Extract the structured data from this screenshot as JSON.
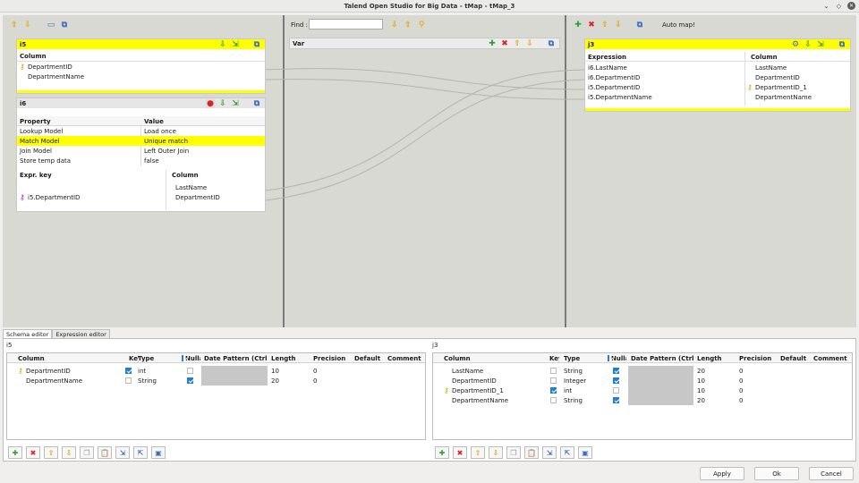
{
  "window": {
    "title": "Talend Open Studio for Big Data - tMap - tMap_3"
  },
  "var_panel": {
    "find_label": "Find :",
    "find_value": "",
    "title": "Var"
  },
  "output_toolbar": {
    "auto_map": "Auto map!"
  },
  "i5": {
    "title": "i5",
    "column_header": "Column",
    "rows": [
      "DepartmentID",
      "DepartmentName"
    ]
  },
  "i6": {
    "title": "i6",
    "prop_headers": [
      "Property",
      "Value"
    ],
    "props": [
      {
        "p": "Lookup Model",
        "v": "Load once"
      },
      {
        "p": "Match Model",
        "v": "Unique match"
      },
      {
        "p": "Join Model",
        "v": "Left Outer Join"
      },
      {
        "p": "Store temp data",
        "v": "false"
      }
    ],
    "expr_headers": [
      "Expr. key",
      "Column"
    ],
    "expr_rows": [
      {
        "e": "",
        "c": "LastName"
      },
      {
        "e": "i5.DepartmentID",
        "c": "DepartmentID"
      }
    ]
  },
  "j3": {
    "title": "j3",
    "headers": [
      "Expression",
      "Column"
    ],
    "rows": [
      {
        "e": "i6.LastName",
        "c": "LastName"
      },
      {
        "e": "i6.DepartmentID",
        "c": "DepartmentID"
      },
      {
        "e": "i5.DepartmentID",
        "c": "DepartmentID_1"
      },
      {
        "e": "i5.DepartmentName",
        "c": "DepartmentName"
      }
    ]
  },
  "tabs": [
    "Schema editor",
    "Expression editor"
  ],
  "schema_left": {
    "name": "i5",
    "headers": [
      "Column",
      "Key",
      "Type",
      "Nullable",
      "Date Pattern (Ctrl+Space)",
      "Length",
      "Precision",
      "Default",
      "Comment"
    ],
    "rows": [
      {
        "col": "DepartmentID",
        "type": "int",
        "len": "10",
        "prec": "0"
      },
      {
        "col": "DepartmentName",
        "type": "String",
        "len": "20",
        "prec": "0"
      }
    ]
  },
  "schema_right": {
    "name": "j3",
    "headers": [
      "Column",
      "Key",
      "Type",
      "Nullable",
      "Date Pattern (Ctrl+Space)",
      "Length",
      "Precision",
      "Default",
      "Comment"
    ],
    "rows": [
      {
        "col": "LastName",
        "type": "String",
        "len": "20",
        "prec": "0"
      },
      {
        "col": "DepartmentID",
        "type": "Integer",
        "len": "10",
        "prec": "0"
      },
      {
        "col": "DepartmentID_1",
        "type": "int",
        "len": "10",
        "prec": "0"
      },
      {
        "col": "DepartmentName",
        "type": "String",
        "len": "20",
        "prec": "0"
      }
    ]
  },
  "buttons": {
    "apply": "Apply",
    "ok": "Ok",
    "cancel": "Cancel"
  }
}
